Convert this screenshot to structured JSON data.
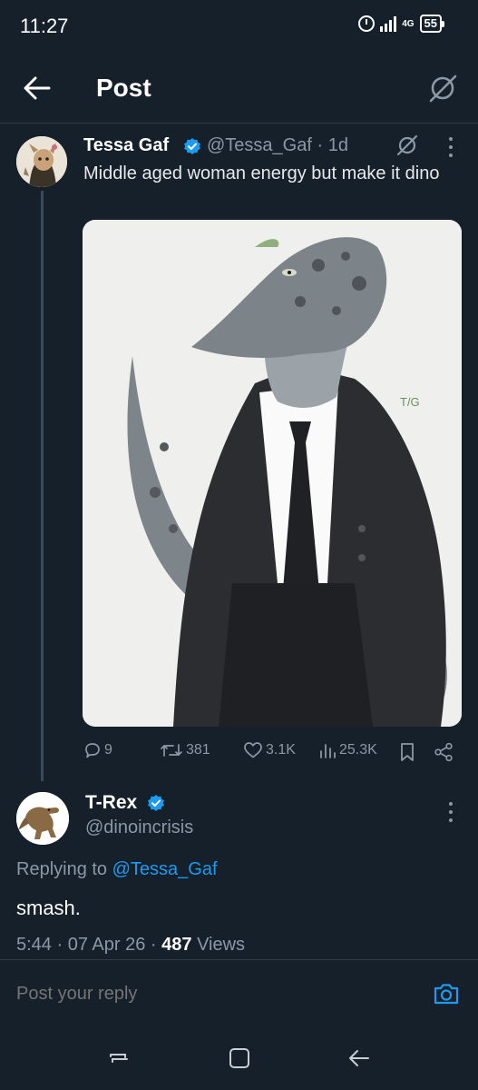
{
  "status": {
    "time": "11:27",
    "network": "4G",
    "battery": "55"
  },
  "header": {
    "title": "Post",
    "back_icon": "back-arrow-icon",
    "grok_icon": "grok-icon"
  },
  "tweet": {
    "name": "Tessa Gaf",
    "handle": "@Tessa_Gaf",
    "separator": " · ",
    "age": "1d",
    "text": "Middle aged woman energy but make it dino",
    "image_signature": "T/G",
    "actions": {
      "replies": "9",
      "reposts": "381",
      "likes": "3.1K",
      "views": "25.3K"
    }
  },
  "reply": {
    "name": "T-Rex",
    "handle": "@dinoincrisis",
    "replying_prefix": "Replying to ",
    "replying_handle": "@Tessa_Gaf",
    "text": "smash.",
    "time": "5:44",
    "date": "07 Apr 26",
    "views_count": "487",
    "views_label": "Views"
  },
  "compose": {
    "placeholder": "Post your reply"
  },
  "colors": {
    "background": "#15202b",
    "accent": "#1d9bf0",
    "muted": "#8b98a5",
    "divider": "#2f3b47"
  }
}
